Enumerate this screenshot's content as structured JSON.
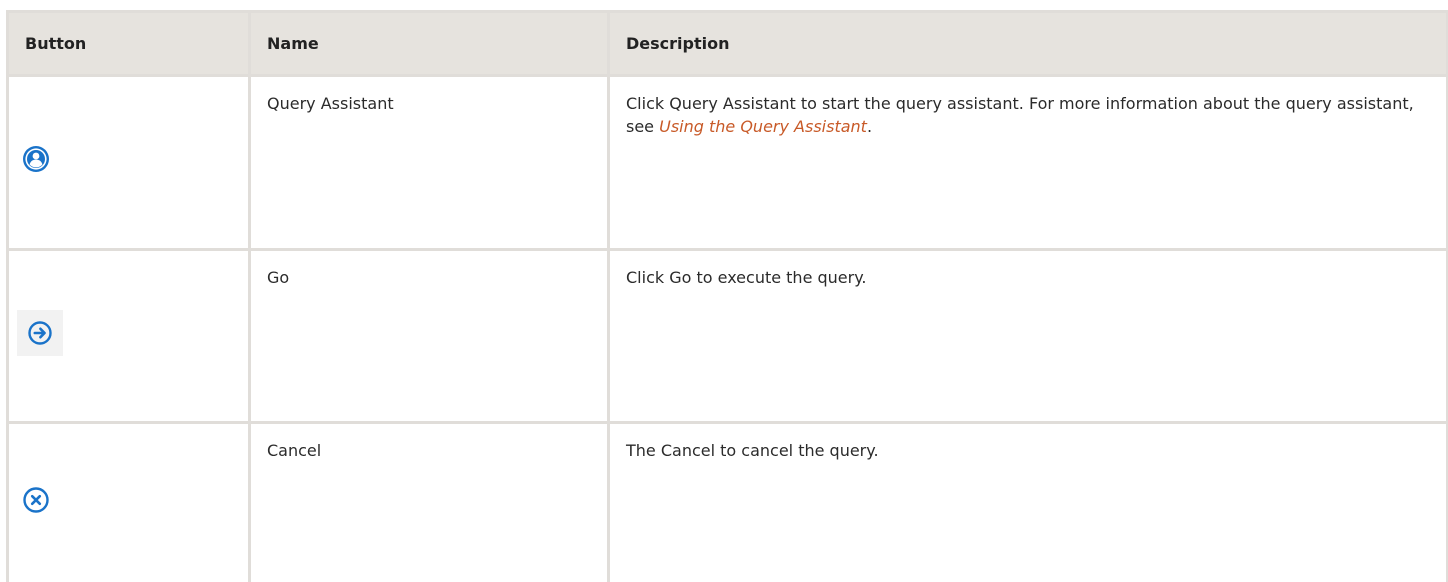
{
  "table": {
    "headers": {
      "button": "Button",
      "name": "Name",
      "description": "Description"
    },
    "rows": [
      {
        "icon": "user-circle-icon",
        "name": "Query Assistant",
        "description_before": "Click Query Assistant to start the query assistant. For more information about the query assistant, see ",
        "description_link": "Using the Query Assistant",
        "description_after": "."
      },
      {
        "icon": "arrow-right-circle-icon",
        "name": "Go",
        "description_before": "Click Go to execute the query.",
        "description_link": "",
        "description_after": ""
      },
      {
        "icon": "close-circle-icon",
        "name": "Cancel",
        "description_before": "The Cancel to cancel the query.",
        "description_link": "",
        "description_after": ""
      }
    ]
  },
  "colors": {
    "header_bg": "#e6e3de",
    "border": "#e0ddd9",
    "icon_blue": "#1a73c9",
    "link": "#c85a28"
  }
}
